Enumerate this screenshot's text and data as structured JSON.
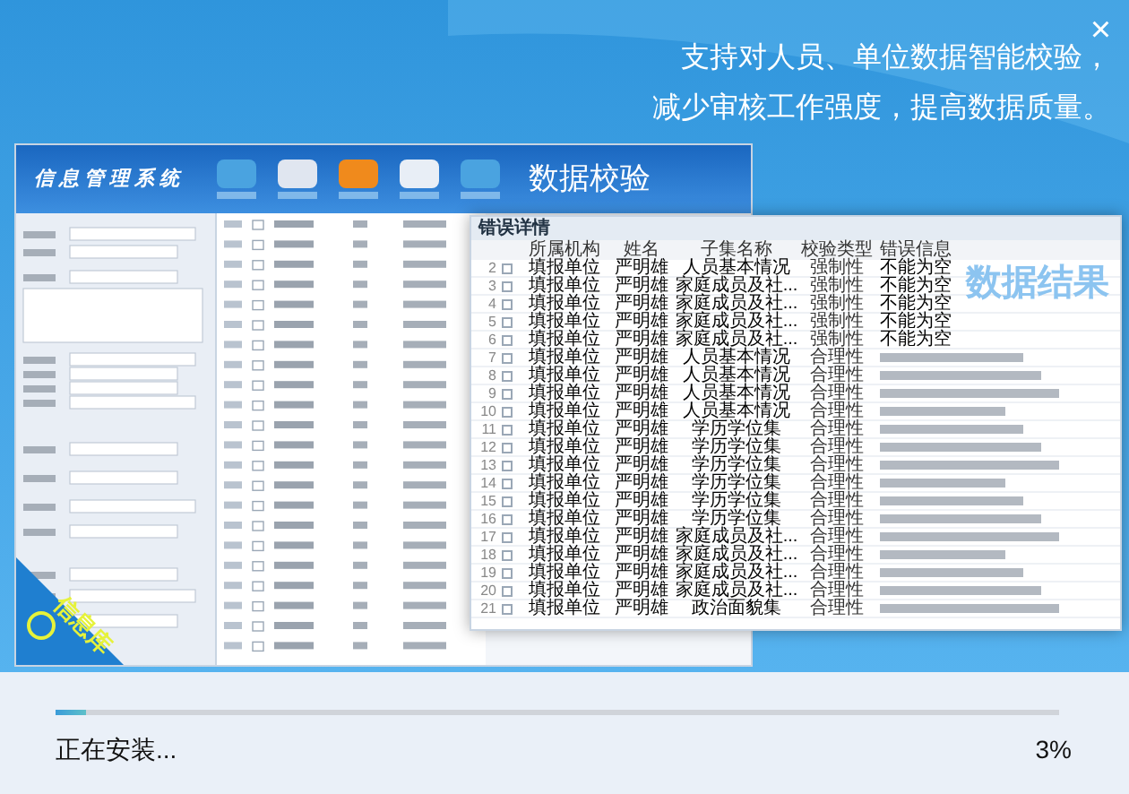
{
  "window": {
    "close": "×"
  },
  "headline": [
    "支持对人员、单位数据智能校验，",
    "减少审核工作强度，提高数据质量。"
  ],
  "app": {
    "title": "信息管理系统",
    "feature": "数据校验",
    "badge": "信息库"
  },
  "result": {
    "label": "数据结果",
    "panel_title": "错误详情",
    "columns": [
      "所属机构",
      "姓名",
      "子集名称",
      "校验类型",
      "错误信息"
    ],
    "rows": [
      {
        "no": "2",
        "org": "填报单位",
        "name": "严明雄",
        "subset": "人员基本情况",
        "type": "强制性",
        "message": "不能为空",
        "checked": false
      },
      {
        "no": "3",
        "org": "填报单位",
        "name": "严明雄",
        "subset": "家庭成员及社...",
        "type": "强制性",
        "message": "不能为空",
        "checked": false
      },
      {
        "no": "4",
        "org": "填报单位",
        "name": "严明雄",
        "subset": "家庭成员及社...",
        "type": "强制性",
        "message": "不能为空",
        "checked": false
      },
      {
        "no": "5",
        "org": "填报单位",
        "name": "严明雄",
        "subset": "家庭成员及社...",
        "type": "强制性",
        "message": "不能为空",
        "checked": false
      },
      {
        "no": "6",
        "org": "填报单位",
        "name": "严明雄",
        "subset": "家庭成员及社...",
        "type": "强制性",
        "message": "不能为空",
        "checked": false
      },
      {
        "no": "7",
        "org": "填报单位",
        "name": "严明雄",
        "subset": "人员基本情况",
        "type": "合理性",
        "checked": false
      },
      {
        "no": "8",
        "org": "填报单位",
        "name": "严明雄",
        "subset": "人员基本情况",
        "type": "合理性",
        "checked": false
      },
      {
        "no": "9",
        "org": "填报单位",
        "name": "严明雄",
        "subset": "人员基本情况",
        "type": "合理性",
        "checked": false
      },
      {
        "no": "10",
        "org": "填报单位",
        "name": "严明雄",
        "subset": "人员基本情况",
        "type": "合理性",
        "checked": false
      },
      {
        "no": "11",
        "org": "填报单位",
        "name": "严明雄",
        "subset": "学历学位集",
        "type": "合理性",
        "checked": false
      },
      {
        "no": "12",
        "org": "填报单位",
        "name": "严明雄",
        "subset": "学历学位集",
        "type": "合理性",
        "checked": false
      },
      {
        "no": "13",
        "org": "填报单位",
        "name": "严明雄",
        "subset": "学历学位集",
        "type": "合理性",
        "checked": false
      },
      {
        "no": "14",
        "org": "填报单位",
        "name": "严明雄",
        "subset": "学历学位集",
        "type": "合理性",
        "checked": false
      },
      {
        "no": "15",
        "org": "填报单位",
        "name": "严明雄",
        "subset": "学历学位集",
        "type": "合理性",
        "checked": false
      },
      {
        "no": "16",
        "org": "填报单位",
        "name": "严明雄",
        "subset": "学历学位集",
        "type": "合理性",
        "checked": false
      },
      {
        "no": "17",
        "org": "填报单位",
        "name": "严明雄",
        "subset": "家庭成员及社...",
        "type": "合理性",
        "checked": false
      },
      {
        "no": "18",
        "org": "填报单位",
        "name": "严明雄",
        "subset": "家庭成员及社...",
        "type": "合理性",
        "checked": false
      },
      {
        "no": "19",
        "org": "填报单位",
        "name": "严明雄",
        "subset": "家庭成员及社...",
        "type": "合理性",
        "checked": false
      },
      {
        "no": "20",
        "org": "填报单位",
        "name": "严明雄",
        "subset": "家庭成员及社...",
        "type": "合理性",
        "checked": false
      },
      {
        "no": "21",
        "org": "填报单位",
        "name": "严明雄",
        "subset": "政治面貌集",
        "type": "合理性",
        "checked": false
      }
    ]
  },
  "progress": {
    "level": 0.03,
    "status": "正在安装...",
    "percent": "3%"
  }
}
